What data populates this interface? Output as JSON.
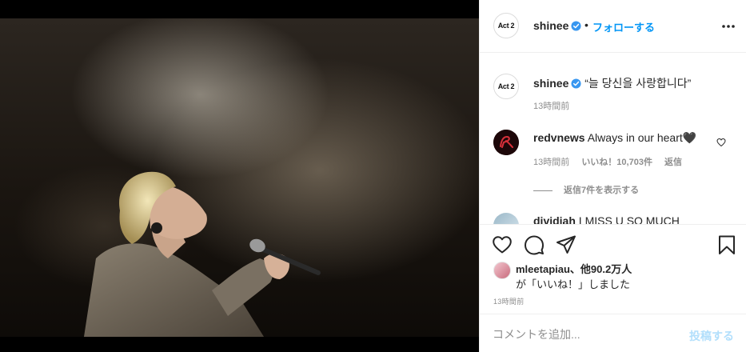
{
  "photo": {
    "alt": ""
  },
  "header": {
    "avatar_label": "Act 2",
    "username": "shinee",
    "separator": "•",
    "follow_label": "フォローする"
  },
  "caption": {
    "avatar_label": "Act 2",
    "username": "shinee",
    "text": "“늘 당신을 사랑합니다”",
    "time": "13時間前"
  },
  "comments": [
    {
      "username": "redvnews",
      "text": "Always in our heart🖤",
      "time": "13時間前",
      "likes": "いいね！10,703件",
      "reply_label": "返信",
      "view_replies": "返信7件を表示する"
    },
    {
      "username": "dividiah",
      "text": "I MISS U SO MUCH"
    }
  ],
  "likes": {
    "line1_user": "mleetapiau",
    "line1_rest": "、他90.2万人",
    "line2": "が「いいね！」しました"
  },
  "post_time": "13時間前",
  "comment_box": {
    "placeholder": "コメントを追加...",
    "post_label": "投稿する"
  },
  "colors": {
    "accent": "#0095f6",
    "verified": "#3897f0",
    "muted": "#8e8e8e",
    "post_disabled": "#b2dffc"
  }
}
